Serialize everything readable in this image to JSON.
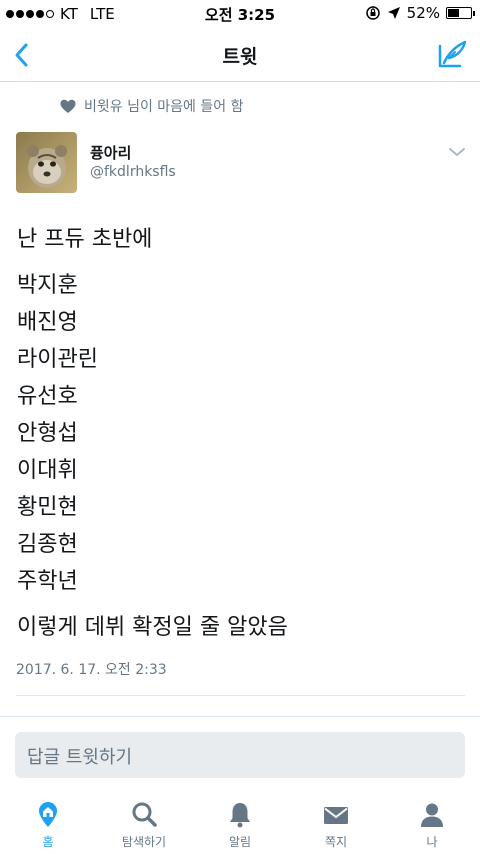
{
  "status_bar": {
    "carrier": "KT",
    "network": "LTE",
    "time": "오전 3:25",
    "battery": "52%",
    "battery_level": 0.52
  },
  "nav": {
    "title": "트윗",
    "back_icon": "chevron-left-icon",
    "compose_icon": "compose-tweet-icon"
  },
  "liked_by": {
    "text": "비윗유 님이 마음에 들어 함",
    "icon": "heart-icon"
  },
  "author": {
    "name": "퓽아리",
    "handle": "@fkdlrhksfls"
  },
  "tweet": {
    "intro": "난 프듀 초반에",
    "names": [
      "박지훈",
      "배진영",
      "라이관린",
      "유선호",
      "안형섭",
      "이대휘",
      "황민현",
      "김종현",
      "주학년"
    ],
    "outro": "이렇게 데뷔 확정일 줄 알았음",
    "date": "2017. 6. 17. 오전 2:33"
  },
  "reply": {
    "placeholder": "답글 트윗하기"
  },
  "tabs": [
    {
      "label": "홈",
      "icon": "home-icon",
      "active": true
    },
    {
      "label": "탐색하기",
      "icon": "search-icon",
      "active": false
    },
    {
      "label": "알림",
      "icon": "bell-icon",
      "active": false
    },
    {
      "label": "쪽지",
      "icon": "envelope-icon",
      "active": false
    },
    {
      "label": "나",
      "icon": "profile-icon",
      "active": false
    }
  ],
  "colors": {
    "accent": "#1da1f2",
    "secondary_text": "#657786",
    "divider": "#e1e8ed"
  }
}
